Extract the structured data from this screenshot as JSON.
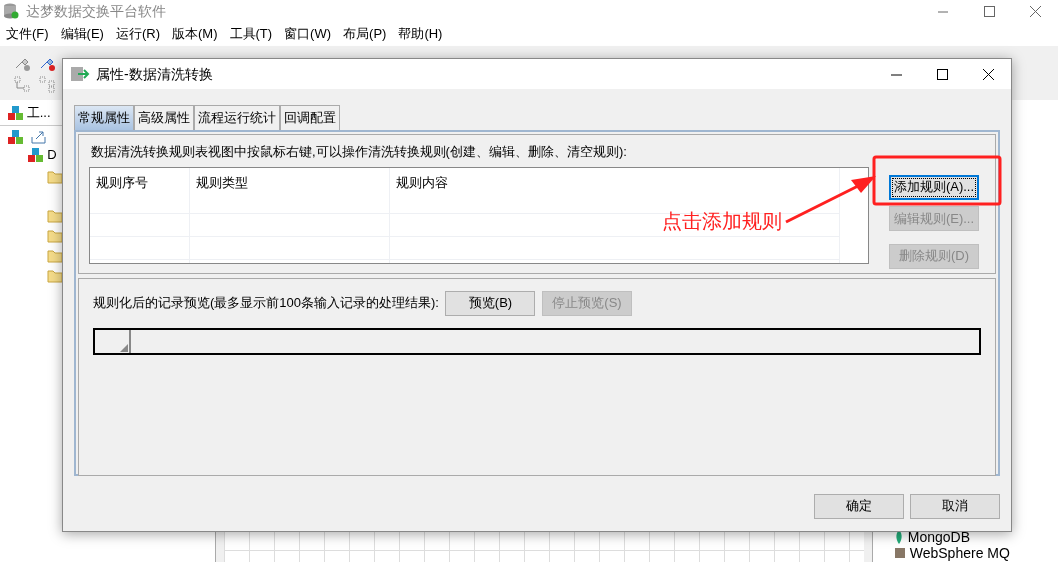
{
  "app": {
    "title": "达梦数据交换平台软件",
    "menu": [
      "文件(F)",
      "编辑(E)",
      "运行(R)",
      "版本(M)",
      "工具(T)",
      "窗口(W)",
      "布局(P)",
      "帮助(H)"
    ],
    "left_panel": {
      "tab": "工...",
      "tree_root": "D"
    },
    "right_panel": {
      "items": [
        "MongoDB",
        "WebSphere MQ"
      ]
    }
  },
  "dialog": {
    "title": "属性-数据清洗转换",
    "tabs": [
      {
        "label": "常规属性",
        "selected": true
      },
      {
        "label": "高级属性",
        "selected": false
      },
      {
        "label": "流程运行统计",
        "selected": false
      },
      {
        "label": "回调配置",
        "selected": false
      }
    ],
    "hint": "数据清洗转换规则表视图中按鼠标右键,可以操作清洗转换规则(创建、编辑、删除、清空规则):",
    "table": {
      "columns": [
        "规则序号",
        "规则类型",
        "规则内容"
      ]
    },
    "rule_buttons": [
      {
        "label": "添加规则(A)...",
        "disabled": false,
        "focused": true
      },
      {
        "label": "编辑规则(E)...",
        "disabled": true,
        "focused": false
      },
      {
        "label": "删除规则(D)",
        "disabled": true,
        "focused": false
      }
    ],
    "preview": {
      "label": "规则化后的记录预览(最多显示前100条输入记录的处理结果):",
      "buttons": [
        {
          "label": "预览(B)",
          "disabled": false
        },
        {
          "label": "停止预览(S)",
          "disabled": true
        }
      ]
    },
    "footer_buttons": [
      "确定",
      "取消"
    ]
  },
  "annotation": {
    "text": "点击添加规则"
  }
}
